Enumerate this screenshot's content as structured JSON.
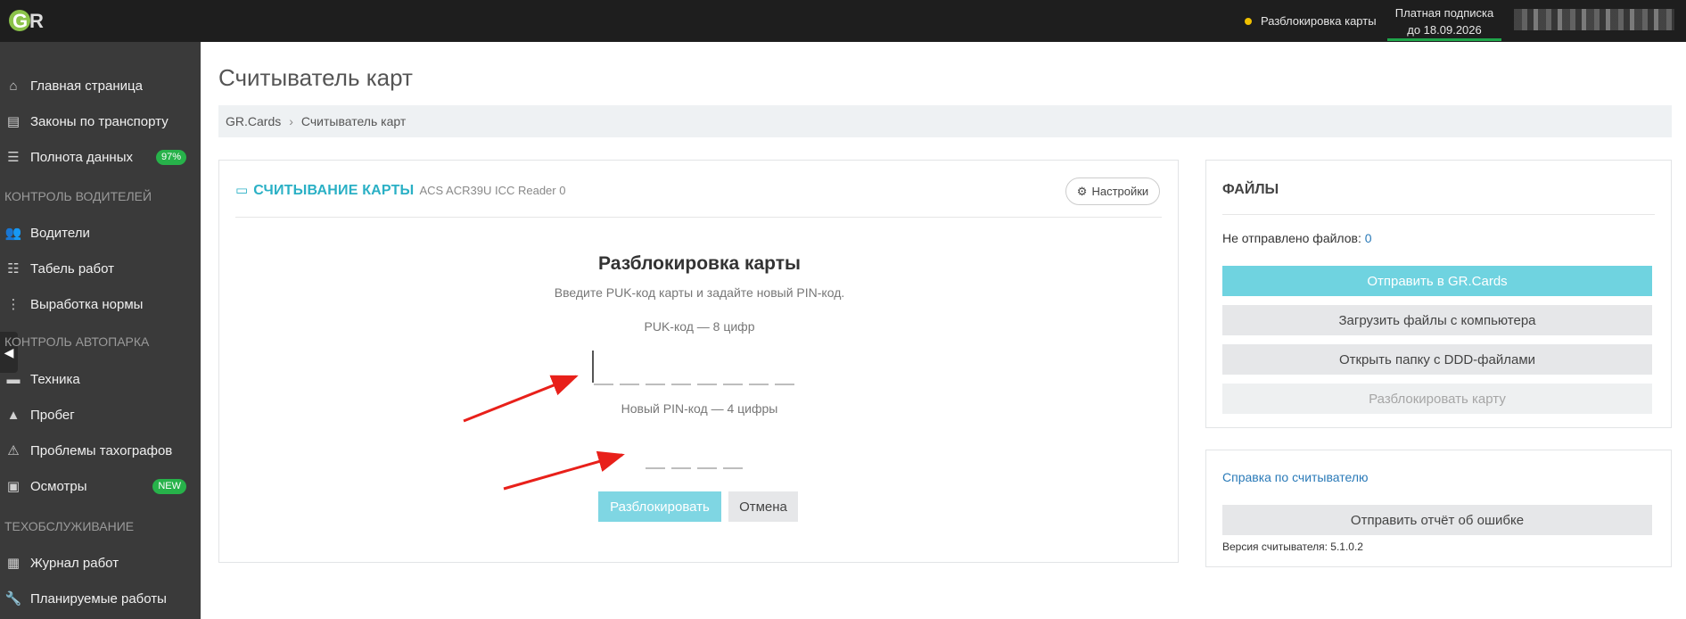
{
  "topbar": {
    "logo_text": "GR",
    "status": "Разблокировка карты",
    "subscription_line1": "Платная подписка",
    "subscription_line2": "до 18.09.2026",
    "status_dot_color": "#f0c000",
    "subscription_bar_color": "#1fa64a"
  },
  "sidebar": {
    "items": [
      {
        "label": "Главная страница",
        "icon": "home-icon"
      },
      {
        "label": "Законы по транспорту",
        "icon": "book-icon"
      },
      {
        "label": "Полнота данных",
        "icon": "chart-icon",
        "badge": "97%"
      },
      {
        "section": "КОНТРОЛЬ ВОДИТЕЛЕЙ"
      },
      {
        "label": "Водители",
        "icon": "users-icon"
      },
      {
        "label": "Табель работ",
        "icon": "list-icon"
      },
      {
        "label": "Выработка нормы",
        "icon": "list-icon"
      },
      {
        "section": "КОНТРОЛЬ АВТОПАРКА"
      },
      {
        "label": "Техника",
        "icon": "bus-icon"
      },
      {
        "label": "Пробег",
        "icon": "road-icon"
      },
      {
        "label": "Проблемы тахографов",
        "icon": "warning-icon"
      },
      {
        "label": "Осмотры",
        "icon": "inspection-icon",
        "badge": "NEW"
      },
      {
        "section": "ТЕХОБСЛУЖИВАНИЕ"
      },
      {
        "label": "Журнал работ",
        "icon": "calendar-icon"
      },
      {
        "label": "Планируемые работы",
        "icon": "wrench-icon"
      }
    ]
  },
  "main": {
    "page_title": "Считыватель карт",
    "breadcrumb": [
      "GR.Cards",
      "Считыватель карт"
    ]
  },
  "reader_panel": {
    "title": "СЧИТЫВАНИЕ КАРТЫ",
    "reader_name": "ACS ACR39U ICC Reader 0",
    "settings_label": "Настройки",
    "unlock_title": "Разблокировка карты",
    "unlock_subtitle": "Введите PUK-код карты и задайте новый PIN-код.",
    "puk_label": "PUK-код — 8 цифр",
    "pin_label": "Новый PIN-код — 4 цифры",
    "unlock_button": "Разблокировать",
    "cancel_button": "Отмена"
  },
  "files_panel": {
    "title": "ФАЙЛЫ",
    "not_sent_label": "Не отправлено файлов:",
    "not_sent_count": "0",
    "send_button": "Отправить в GR.Cards",
    "upload_button": "Загрузить файлы с компьютера",
    "folder_button": "Открыть папку с DDD-файлами",
    "unlock_card_button": "Разблокировать карту"
  },
  "help_panel": {
    "help_link": "Справка по считывателю",
    "report_button": "Отправить отчёт об ошибке",
    "version": "Версия считывателя: 5.1.0.2"
  },
  "colors": {
    "accent": "#2ab0c5",
    "sidebar_bg": "#3a3a3a",
    "topbar_bg": "#1e1e1e",
    "badge_green": "#27b24a",
    "arrow_red": "#e8201a"
  }
}
